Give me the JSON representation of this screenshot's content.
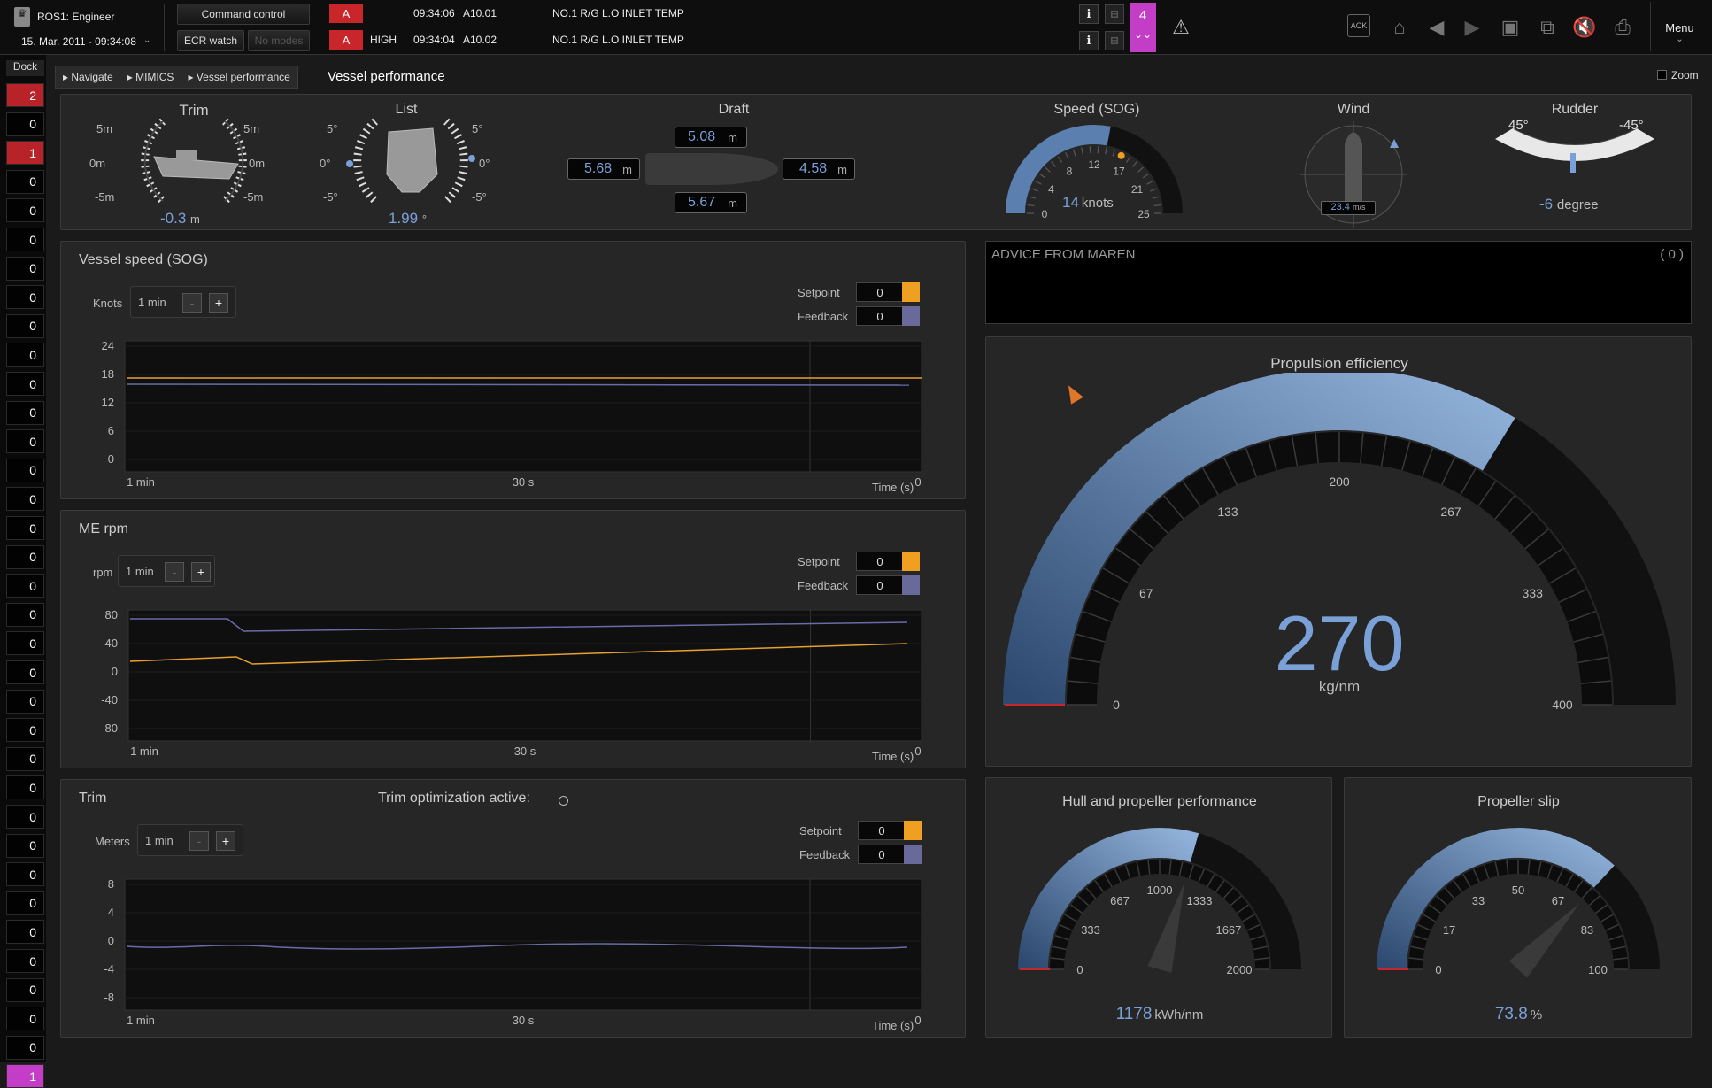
{
  "header": {
    "user": "ROS1: Engineer",
    "datetime": "15. Mar. 2011 - 09:34:08",
    "command_control": "Command control",
    "ecr_watch": "ECR watch",
    "no_modes": "No modes",
    "alarm_count": "4",
    "menu": "Menu",
    "ack": "ACK",
    "alarms": [
      {
        "badge": "A",
        "priority": "",
        "time": "09:34:06",
        "code": "A10.01",
        "text": "NO.1 R/G L.O INLET TEMP"
      },
      {
        "badge": "A",
        "priority": "HIGH",
        "time": "09:34:04",
        "code": "A10.02",
        "text": "NO.1 R/G L.O INLET TEMP"
      }
    ]
  },
  "dock": {
    "label": "Dock",
    "items": [
      "2",
      "0",
      "1",
      "0",
      "0",
      "0",
      "0",
      "0",
      "0",
      "0",
      "0",
      "0",
      "0",
      "0",
      "0",
      "0",
      "0",
      "0",
      "0",
      "0",
      "0",
      "0",
      "0",
      "0",
      "0",
      "0",
      "0",
      "0",
      "0",
      "0",
      "0",
      "0",
      "0",
      "0",
      "1"
    ]
  },
  "breadcrumb": {
    "items": [
      "Navigate",
      "MIMICS",
      "Vessel performance"
    ],
    "current": "Vessel performance",
    "zoom": "Zoom"
  },
  "instruments": {
    "trim": {
      "title": "Trim",
      "value": "-0.3",
      "unit": "m",
      "scale_top": "5m",
      "scale_mid": "0m",
      "scale_bot": "-5m"
    },
    "list": {
      "title": "List",
      "value": "1.99",
      "unit": "°",
      "scale_top": "5°",
      "scale_mid": "0°",
      "scale_bot": "-5°"
    },
    "draft": {
      "title": "Draft",
      "top": "5.08",
      "left": "5.68",
      "right": "4.58",
      "bottom": "5.67",
      "unit": "m"
    },
    "speed": {
      "title": "Speed (SOG)",
      "value": "14",
      "unit": "knots",
      "ticks": [
        "0",
        "4",
        "8",
        "12",
        "17",
        "21",
        "25"
      ],
      "max": 25
    },
    "wind": {
      "title": "Wind",
      "value": "23.4",
      "unit": "m/s"
    },
    "rudder": {
      "title": "Rudder",
      "value": "-6",
      "unit": "degree",
      "left": "45°",
      "right": "-45°"
    }
  },
  "advice": {
    "title": "ADVICE FROM MAREN",
    "count": "( 0 )"
  },
  "charts": {
    "vessel_speed": {
      "title": "Vessel speed (SOG)",
      "unit": "Knots",
      "window": "1 min",
      "setpoint_label": "Setpoint",
      "setpoint": "0",
      "feedback_label": "Feedback",
      "feedback": "0",
      "xlabels": [
        "1 min",
        "30 s",
        "0"
      ],
      "xtitle": "Time (s)",
      "yticks": [
        "24",
        "18",
        "12",
        "6",
        "0"
      ]
    },
    "me_rpm": {
      "title": "ME rpm",
      "unit": "rpm",
      "window": "1 min",
      "setpoint_label": "Setpoint",
      "setpoint": "0",
      "feedback_label": "Feedback",
      "feedback": "0",
      "xlabels": [
        "1 min",
        "30 s",
        "0"
      ],
      "xtitle": "Time (s)",
      "yticks": [
        "80",
        "40",
        "0",
        "-40",
        "-80"
      ]
    },
    "trim": {
      "title": "Trim",
      "extra": "Trim optimization active:",
      "unit": "Meters",
      "window": "1 min",
      "setpoint_label": "Setpoint",
      "setpoint": "0",
      "feedback_label": "Feedback",
      "feedback": "0",
      "xlabels": [
        "1 min",
        "30 s",
        "0"
      ],
      "xtitle": "Time (s)",
      "yticks": [
        "8",
        "4",
        "0",
        "-4",
        "-8"
      ]
    }
  },
  "gauges": {
    "propulsion": {
      "title": "Propulsion efficiency",
      "value": "270",
      "unit": "kg/nm",
      "min": 0,
      "max": 400,
      "ticks": [
        "0",
        "67",
        "133",
        "200",
        "267",
        "333",
        "400"
      ]
    },
    "hull": {
      "title": "Hull and propeller performance",
      "value": "1178",
      "unit": "kWh/nm",
      "min": 0,
      "max": 2000,
      "ticks": [
        "0",
        "333",
        "667",
        "1000",
        "1333",
        "1667",
        "2000"
      ]
    },
    "slip": {
      "title": "Propeller slip",
      "value": "73.8",
      "unit": "%",
      "min": 0,
      "max": 100,
      "ticks": [
        "0",
        "17",
        "33",
        "50",
        "67",
        "83",
        "100"
      ]
    }
  },
  "colors": {
    "setpoint": "#f0a020",
    "feedback": "#6a6a9a",
    "alarm": "#c8262a",
    "accent": "#7aa0d8",
    "badge": "#c43dc6"
  }
}
